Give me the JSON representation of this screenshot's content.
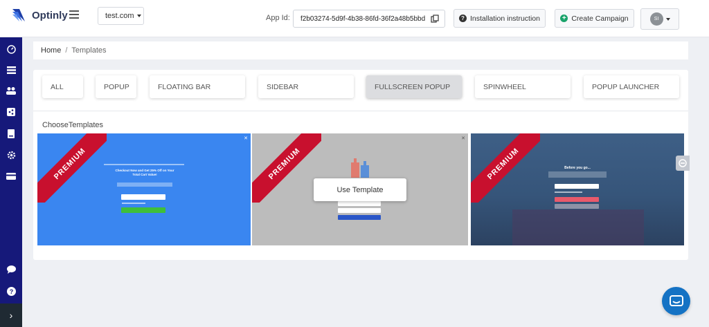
{
  "header": {
    "brand": "Optinly",
    "site_selector": "test.com",
    "app_id_label": "App Id:",
    "app_id_value": "f2b03274-5d9f-4b38-86fd-36f2a48b5bbd",
    "install_button": "Installation instruction",
    "create_button": "Create Campaign",
    "avatar_initials": "SI"
  },
  "breadcrumb": {
    "home": "Home",
    "separator": "/",
    "current": "Templates"
  },
  "tabs": [
    {
      "label": "ALL",
      "active": false
    },
    {
      "label": "POPUP",
      "active": false
    },
    {
      "label": "FLOATING BAR",
      "active": false
    },
    {
      "label": "SIDEBAR",
      "active": false
    },
    {
      "label": "FULLSCREEN POPUP",
      "active": true
    },
    {
      "label": "SPINWHEEL",
      "active": false
    },
    {
      "label": "POPUP LAUNCHER",
      "active": false
    }
  ],
  "section_title": "ChooseTemplates",
  "templates": [
    {
      "badge": "PREMIUM",
      "headline": "Checkout Now and Get 25% Off on Your Total Cart Value!",
      "button_color": "#3fbf3a"
    },
    {
      "badge": "PREMIUM",
      "action": "Use Template",
      "button_color": "#2a56c8"
    },
    {
      "badge": "PREMIUM",
      "headline": "Before you go...",
      "button_color": "#e85a6b"
    }
  ],
  "colors": {
    "sidebar": "#16197a",
    "accent_green": "#1aa36b",
    "premium_ribbon": "#c8102e",
    "chat": "#1472c4"
  }
}
